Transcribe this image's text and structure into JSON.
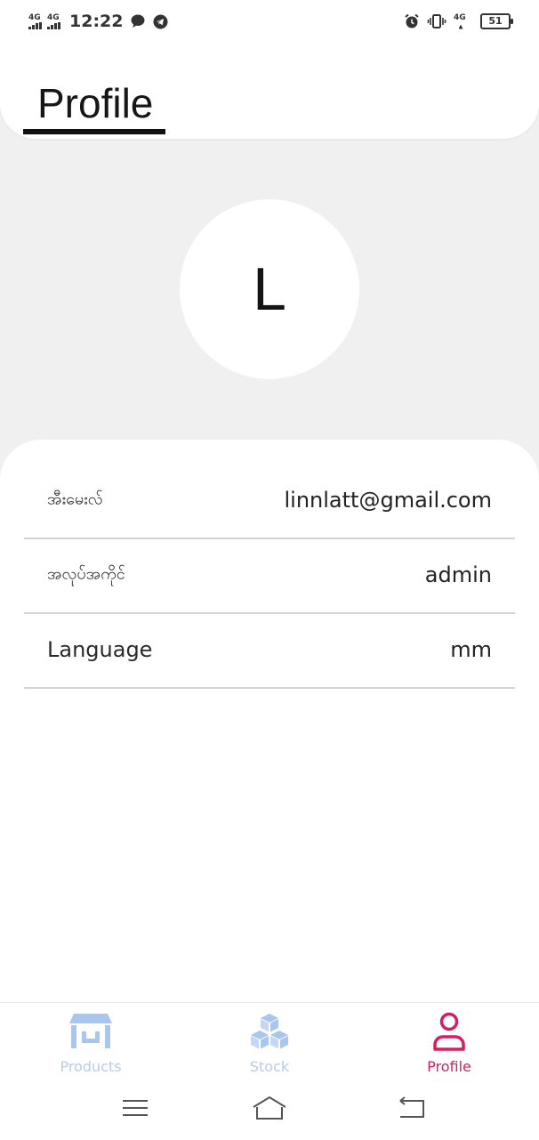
{
  "status_bar": {
    "network_1": "4G",
    "network_2": "4G",
    "time": "12:22",
    "network_3": "4G",
    "battery": "51"
  },
  "header": {
    "title": "Profile"
  },
  "avatar": {
    "initial": "L"
  },
  "info": {
    "rows": [
      {
        "label": "အီးမေးလ်",
        "value": "linnlatt@gmail.com"
      },
      {
        "label": "အလုပ်အကိုင်",
        "value": "admin"
      },
      {
        "label": "Language",
        "value": "mm"
      }
    ]
  },
  "bottom_nav": {
    "items": [
      {
        "label": "Products",
        "icon": "store-icon"
      },
      {
        "label": "Stock",
        "icon": "boxes-icon"
      },
      {
        "label": "Profile",
        "icon": "person-icon"
      }
    ],
    "active": "Profile"
  },
  "colors": {
    "accent_active": "#d51f65",
    "inactive": "#b6cce9",
    "background": "#f0f0f0"
  }
}
